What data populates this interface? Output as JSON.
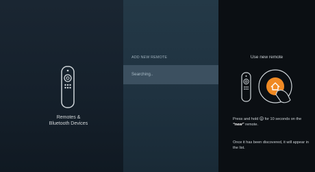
{
  "left": {
    "label_line1": "Remotes &",
    "label_line2": "Bluetooth Devices"
  },
  "middle": {
    "title": "ADD NEW REMOTE",
    "search_text": "Searching.."
  },
  "right": {
    "title": "Use new remote",
    "instruction_pre": "Press and hold",
    "instruction_mid": "for 10 seconds on the",
    "instruction_bold": "“new”",
    "instruction_post": "remote.",
    "instruction2": "Once it has been discovered, it will appear in the list."
  },
  "colors": {
    "accent": "#f08a24"
  },
  "icons": {
    "home_button": "home-icon",
    "remote": "remote-icon"
  }
}
